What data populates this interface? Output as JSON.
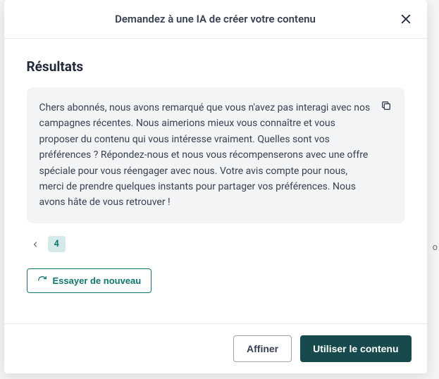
{
  "header": {
    "title": "Demandez à une IA de créer votre contenu"
  },
  "body": {
    "section_title": "Résultats",
    "result_text": "Chers abonnés, nous avons remarqué que vous n'avez pas interagi avec nos campagnes récentes. Nous aimerions mieux vous connaître et vous proposer du contenu qui vous intéresse vraiment. Quelles sont vos préférences ? Répondez-nous et nous vous récompenserons avec une offre spéciale pour vous réengager avec nous. Votre avis compte pour nous, merci de prendre quelques instants pour partager vos préférences. Nous avons hâte de vous retrouver !",
    "page_number": "4",
    "retry_label": "Essayer de nouveau"
  },
  "footer": {
    "refine_label": "Affiner",
    "use_label": "Utiliser le contenu"
  },
  "background": {
    "hint_char": "o"
  }
}
